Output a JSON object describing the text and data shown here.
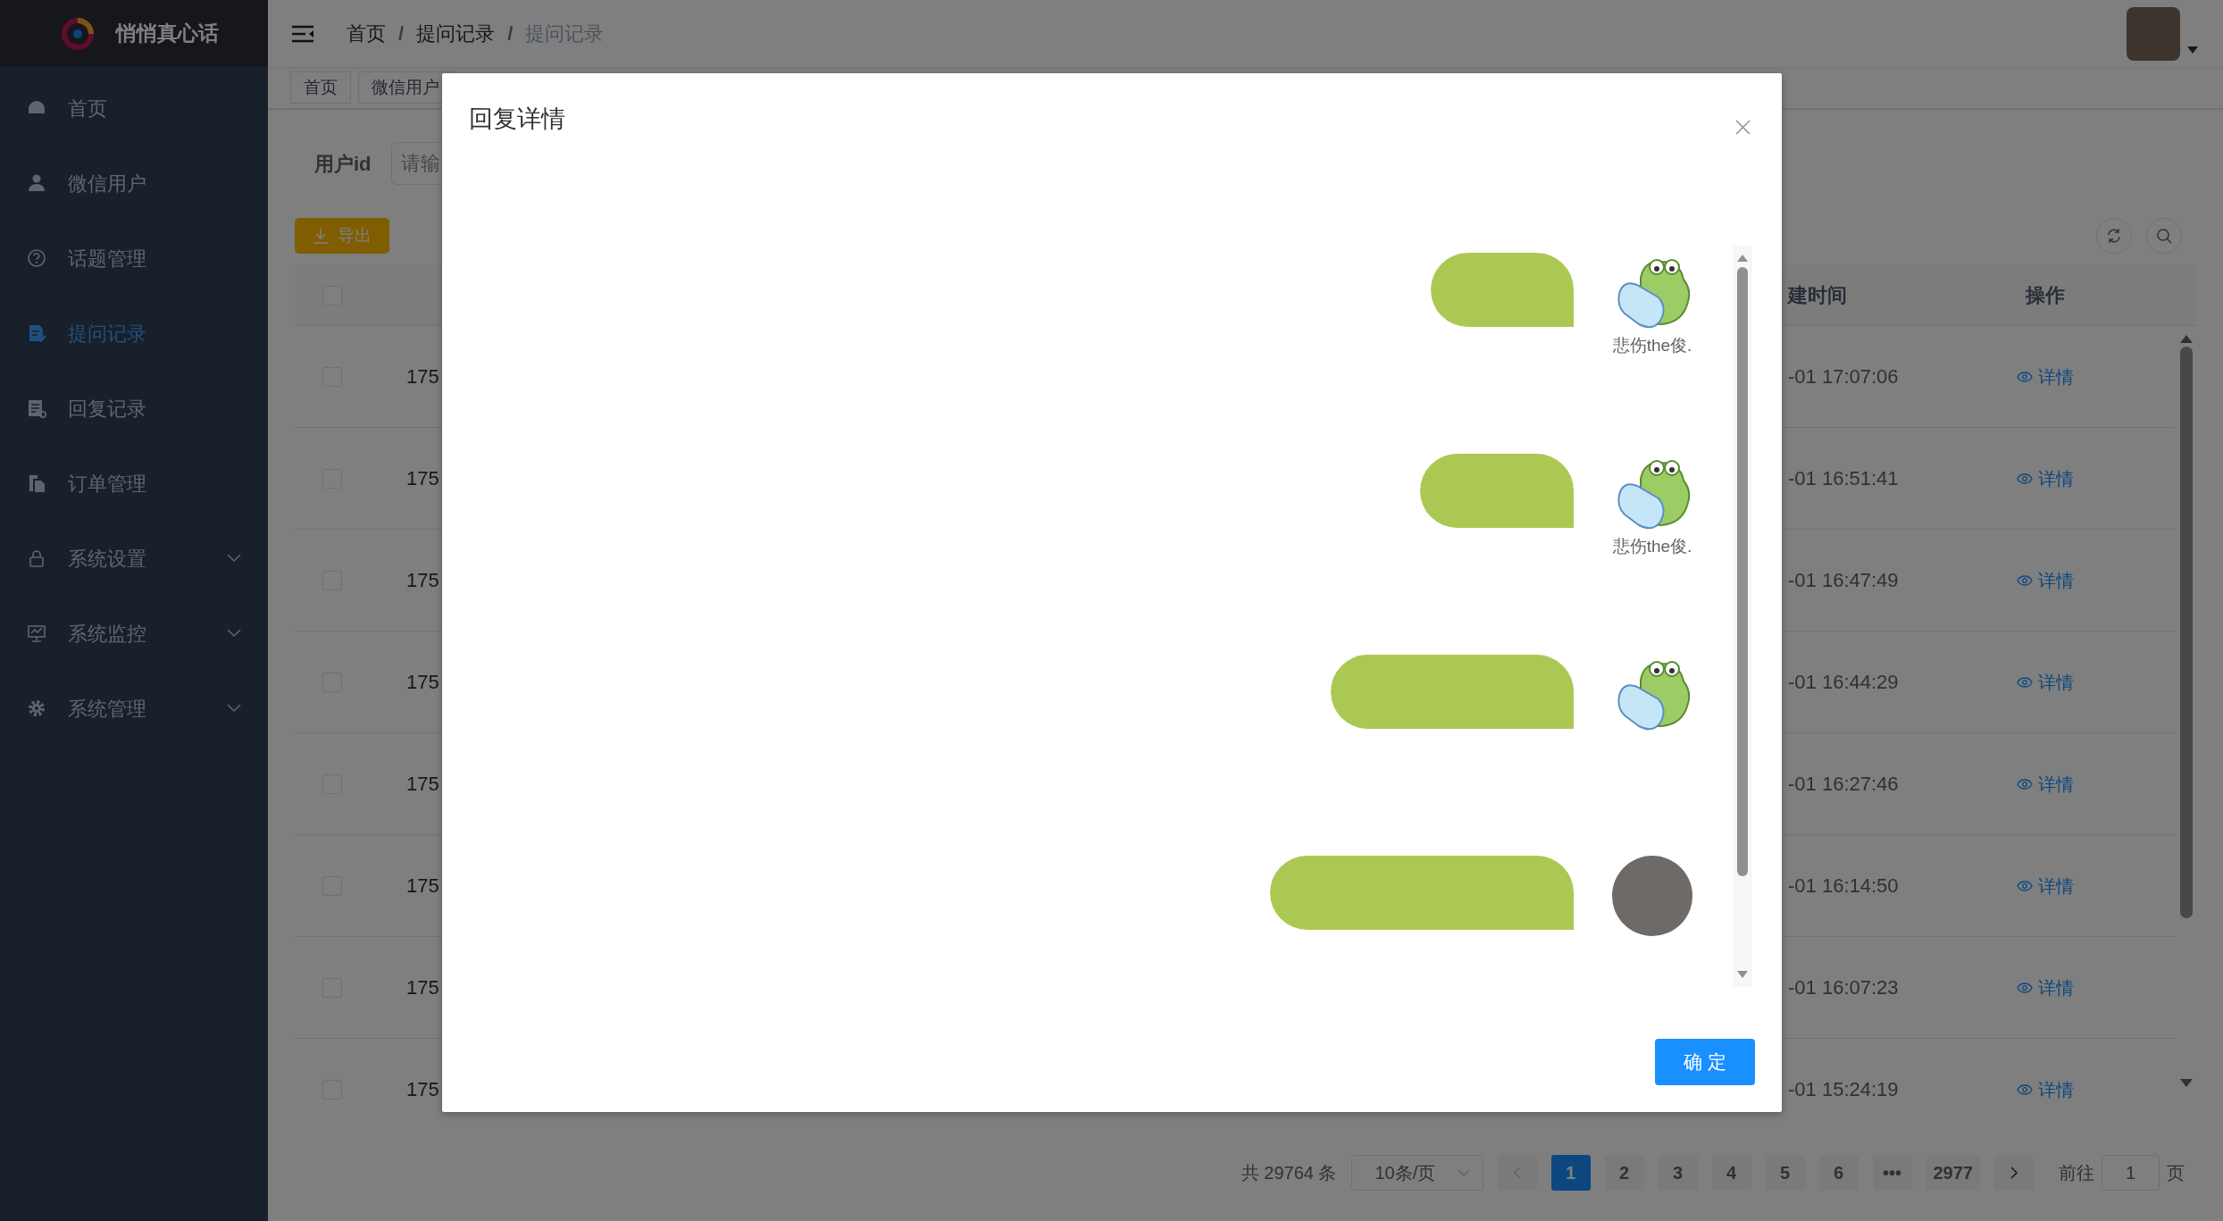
{
  "sidebar": {
    "logo_text": "悄悄真心话",
    "items": [
      {
        "label": "首页",
        "selected": false,
        "expandable": false
      },
      {
        "label": "微信用户",
        "selected": false,
        "expandable": false
      },
      {
        "label": "话题管理",
        "selected": false,
        "expandable": false
      },
      {
        "label": "提问记录",
        "selected": true,
        "expandable": false
      },
      {
        "label": "回复记录",
        "selected": false,
        "expandable": false
      },
      {
        "label": "订单管理",
        "selected": false,
        "expandable": false
      },
      {
        "label": "系统设置",
        "selected": false,
        "expandable": true
      },
      {
        "label": "系统监控",
        "selected": false,
        "expandable": true
      },
      {
        "label": "系统管理",
        "selected": false,
        "expandable": true
      }
    ]
  },
  "header": {
    "separator": "/",
    "breadcrumbs": [
      "首页",
      "提问记录",
      "提问记录"
    ]
  },
  "tabs": [
    {
      "label": "首页"
    },
    {
      "label": "微信用户"
    }
  ],
  "filter": {
    "label": "用户id",
    "placeholder": "请输"
  },
  "export_button": "导出",
  "table": {
    "header_checked": false,
    "columns": [
      "建时间",
      "操作"
    ],
    "rows": [
      {
        "checked": false,
        "column_2": "175",
        "created": "-01 17:07:06",
        "action": "详情"
      },
      {
        "checked": false,
        "column_2": "175",
        "created": "-01 16:51:41",
        "action": "详情"
      },
      {
        "checked": false,
        "column_2": "175",
        "created": "-01 16:47:49",
        "action": "详情"
      },
      {
        "checked": false,
        "column_2": "175",
        "created": "-01 16:44:29",
        "action": "详情"
      },
      {
        "checked": false,
        "column_2": "175",
        "created": "-01 16:27:46",
        "action": "详情"
      },
      {
        "checked": false,
        "column_2": "175",
        "created": "-01 16:14:50",
        "action": "详情"
      },
      {
        "checked": false,
        "column_2": "175",
        "created": "-01 16:07:23",
        "action": "详情"
      },
      {
        "checked": false,
        "column_2": "175",
        "created": "-01 15:24:19",
        "action": "详情"
      }
    ]
  },
  "pagination": {
    "total": "共 29764 条",
    "page_size": "10条/页",
    "pages": [
      {
        "label": "1",
        "selected": true
      },
      {
        "label": "2",
        "selected": false
      },
      {
        "label": "3",
        "selected": false
      },
      {
        "label": "4",
        "selected": false
      },
      {
        "label": "5",
        "selected": false
      },
      {
        "label": "6",
        "selected": false
      },
      {
        "label": "•••",
        "selected": false
      },
      {
        "label": "2977",
        "selected": false
      }
    ],
    "goto_label": "前往",
    "goto_value": "1",
    "page_unit": "页"
  },
  "dialog": {
    "title": "回复详情",
    "messages": [
      {
        "kind": "sticker",
        "name": "悲伤the俊."
      },
      {
        "kind": "sticker",
        "name": "悲伤the俊."
      },
      {
        "kind": "sticker"
      },
      {
        "kind": "photo"
      }
    ],
    "confirm_button": "确 定"
  }
}
